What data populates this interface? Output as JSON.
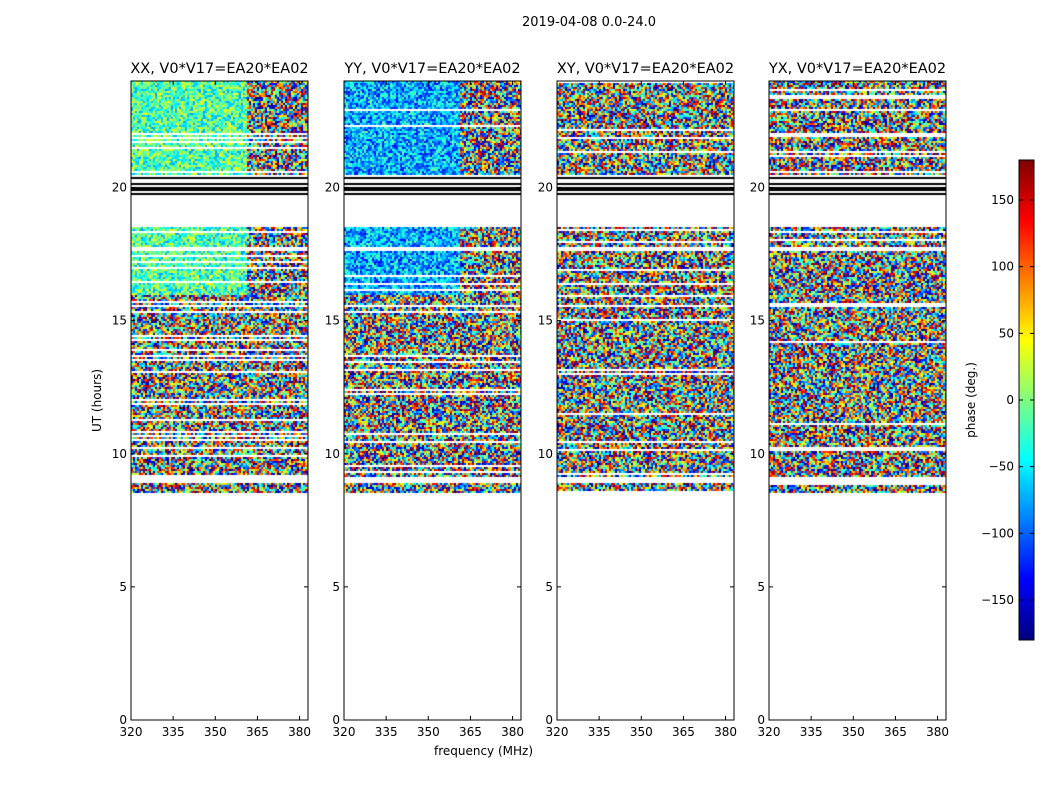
{
  "suptitle": "2019-04-08 0.0-24.0",
  "chart_data": [
    {
      "type": "heatmap",
      "title": "XX, V0*V17=EA20*EA02",
      "xlabel": "",
      "ylabel": "UT (hours)",
      "xlim": [
        320,
        383
      ],
      "ylim": [
        0,
        24
      ],
      "xticks": [
        320,
        335,
        350,
        365,
        380
      ],
      "yticks": [
        0,
        5,
        10,
        15,
        20
      ],
      "value_range": [
        -180,
        180
      ],
      "data_rows_hours": [
        [
          8.5,
          18.5
        ],
        [
          19.7,
          24.0
        ]
      ],
      "flagged_hours": [
        [
          19.0,
          20.5
        ]
      ],
      "gap_hours": [
        [
          8.9,
          9.1
        ],
        [
          15.5,
          15.6
        ],
        [
          17.6,
          17.8
        ]
      ],
      "low_noise_hours": [
        [
          16.0,
          18.5
        ],
        [
          20.5,
          24.0
        ]
      ]
    },
    {
      "type": "heatmap",
      "title": "YY, V0*V17=EA20*EA02",
      "xlabel": "frequency (MHz)",
      "ylabel": "",
      "xlim": [
        320,
        383
      ],
      "ylim": [
        0,
        24
      ],
      "xticks": [
        320,
        335,
        350,
        365,
        380
      ],
      "yticks": [
        0,
        5,
        10,
        15,
        20
      ],
      "value_range": [
        -180,
        180
      ],
      "data_rows_hours": [
        [
          8.5,
          18.5
        ],
        [
          19.7,
          24.0
        ]
      ],
      "flagged_hours": [
        [
          19.0,
          20.5
        ]
      ],
      "gap_hours": [
        [
          8.9,
          9.1
        ],
        [
          15.5,
          15.6
        ],
        [
          17.6,
          17.8
        ]
      ],
      "low_noise_hours": [
        [
          16.0,
          18.5
        ],
        [
          20.5,
          24.0
        ]
      ]
    },
    {
      "type": "heatmap",
      "title": "XY, V0*V17=EA20*EA02",
      "xlabel": "",
      "ylabel": "",
      "xlim": [
        320,
        383
      ],
      "ylim": [
        0,
        24
      ],
      "xticks": [
        320,
        335,
        350,
        365,
        380
      ],
      "yticks": [
        0,
        5,
        10,
        15,
        20
      ],
      "value_range": [
        -180,
        180
      ],
      "data_rows_hours": [
        [
          8.5,
          18.5
        ],
        [
          19.7,
          24.0
        ]
      ],
      "flagged_hours": [
        [
          19.0,
          20.5
        ]
      ],
      "gap_hours": [
        [
          8.9,
          9.1
        ],
        [
          15.5,
          15.6
        ],
        [
          17.6,
          17.8
        ]
      ],
      "low_noise_hours": []
    },
    {
      "type": "heatmap",
      "title": "YX, V0*V17=EA20*EA02",
      "xlabel": "",
      "ylabel": "",
      "xlim": [
        320,
        383
      ],
      "ylim": [
        0,
        24
      ],
      "xticks": [
        320,
        335,
        350,
        365,
        380
      ],
      "yticks": [
        0,
        5,
        10,
        15,
        20
      ],
      "value_range": [
        -180,
        180
      ],
      "data_rows_hours": [
        [
          8.5,
          18.5
        ],
        [
          19.7,
          24.0
        ]
      ],
      "flagged_hours": [
        [
          19.0,
          20.5
        ]
      ],
      "gap_hours": [
        [
          8.9,
          9.1
        ],
        [
          15.5,
          15.6
        ],
        [
          17.6,
          17.8
        ]
      ],
      "low_noise_hours": []
    }
  ],
  "colorbar": {
    "label": "phase (deg.)",
    "ticks": [
      150,
      100,
      50,
      0,
      -50,
      -100,
      -150
    ],
    "range": [
      -180,
      180
    ],
    "colormap": "jet"
  }
}
